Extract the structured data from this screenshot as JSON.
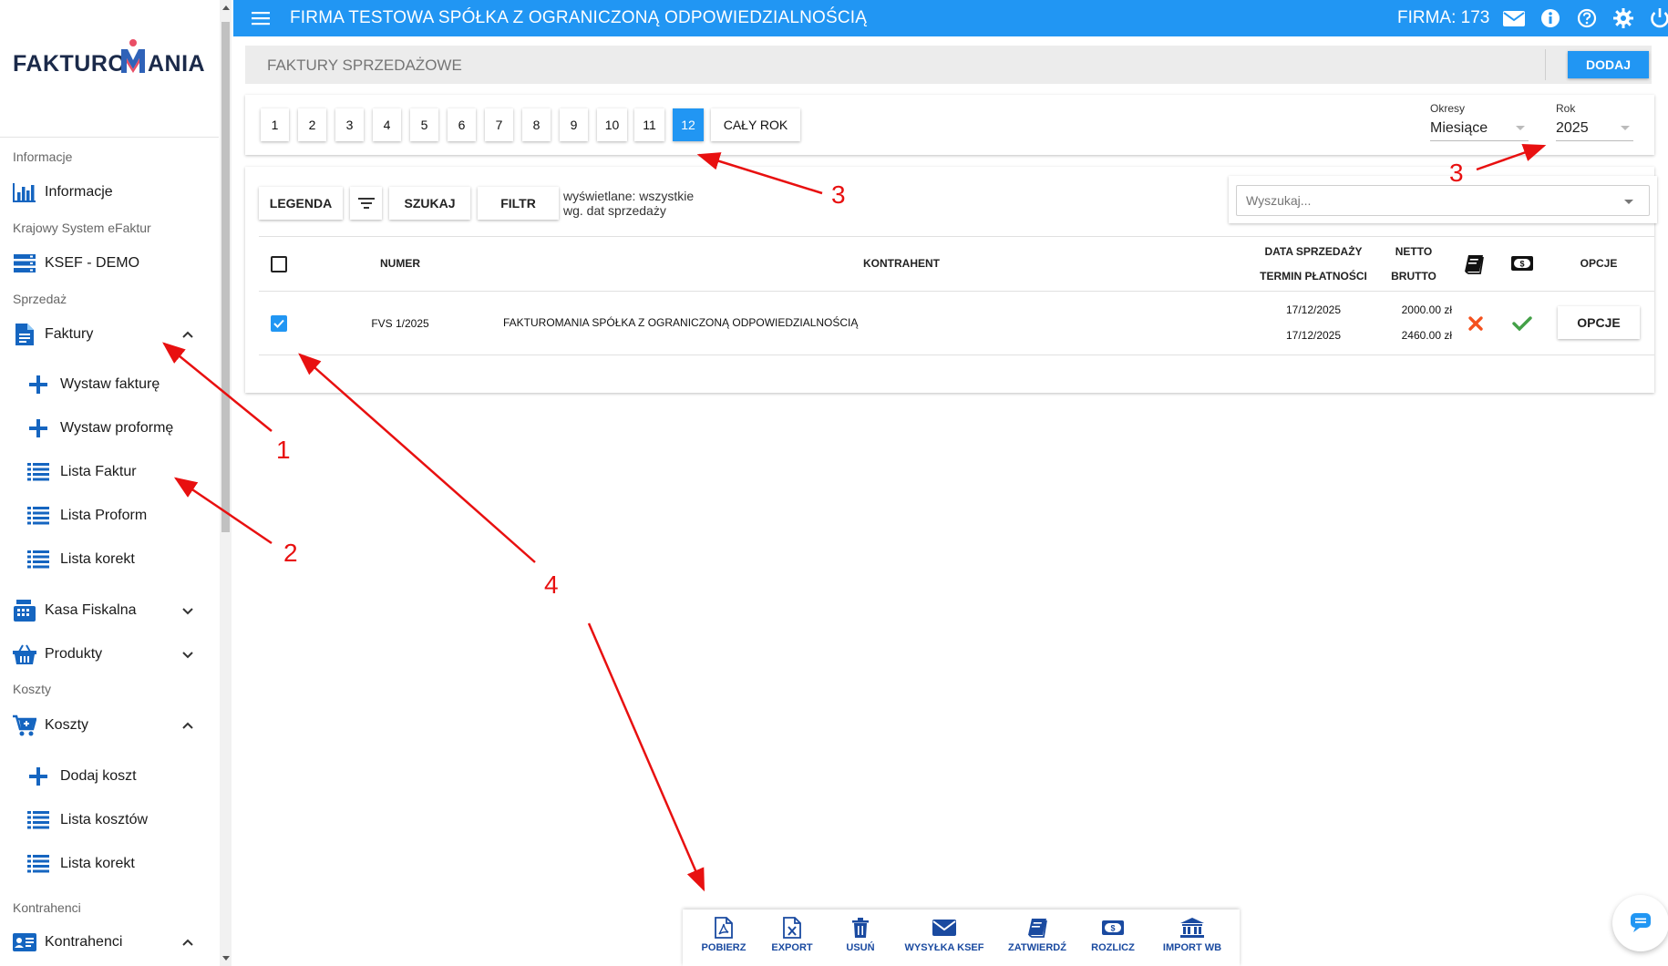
{
  "app": {
    "logo_text_left": "FAKTURO",
    "logo_text_right": "ANIA",
    "company_title": "FIRMA TESTOWA SPÓŁKA Z OGRANICZONĄ ODPOWIEDZIALNOŚCIĄ",
    "firma_label": "FIRMA: 173",
    "brand_color": "#2196f3"
  },
  "sidebar": {
    "sections": {
      "informacje": "Informacje",
      "ksef": "Krajowy System eFaktur",
      "sprzedaz": "Sprzedaż",
      "koszty": "Koszty",
      "kontrahenci": "Kontrahenci"
    },
    "items": {
      "informacje": "Informacje",
      "ksef_demo": "KSEF - DEMO",
      "faktury": "Faktury",
      "wystaw_fakture": "Wystaw fakturę",
      "wystaw_proforme": "Wystaw proformę",
      "lista_faktur": "Lista Faktur",
      "lista_proform": "Lista Proform",
      "lista_korekt": "Lista korekt",
      "kasa_fiskalna": "Kasa Fiskalna",
      "produkty": "Produkty",
      "koszty": "Koszty",
      "dodaj_koszt": "Dodaj koszt",
      "lista_kosztow": "Lista kosztów",
      "lista_korekt_koszty": "Lista korekt",
      "kontrahenci": "Kontrahenci"
    }
  },
  "header": {
    "title": "FAKTURY SPRZEDAŻOWE",
    "add_label": "DODAJ"
  },
  "periods": {
    "months": [
      "1",
      "2",
      "3",
      "4",
      "5",
      "6",
      "7",
      "8",
      "9",
      "10",
      "11",
      "12"
    ],
    "active_month": "12",
    "whole_year": "CAŁY ROK",
    "okresy_label": "Okresy",
    "okresy_value": "Miesiące",
    "rok_label": "Rok",
    "rok_value": "2025"
  },
  "toolbar": {
    "legenda": "LEGENDA",
    "szukaj": "SZUKAJ",
    "filtr": "FILTR",
    "info_line1": "wyświetlane: wszystkie",
    "info_line2": "wg. dat sprzedaży",
    "search_placeholder": "Wyszukaj..."
  },
  "table": {
    "headers": {
      "numer": "NUMER",
      "kontrahent": "KONTRAHENT",
      "data_sprzedazy": "DATA SPRZEDAŻY",
      "termin_platnosci": "TERMIN PŁATNOŚCI",
      "netto": "NETTO",
      "brutto": "BRUTTO",
      "opcje": "OPCJE"
    },
    "rows": [
      {
        "numer": "FVS 1/2025",
        "kontrahent": "FAKTUROMANIA SPÓŁKA Z OGRANICZONĄ ODPOWIEDZIALNOŚCIĄ",
        "data_sprzedazy": "17/12/2025",
        "termin_platnosci": "17/12/2025",
        "netto": "2000.00 zł",
        "brutto": "2460.00 zł",
        "opcje": "OPCJE",
        "checked": true
      }
    ]
  },
  "actions": {
    "pobierz": "POBIERZ",
    "export": "EXPORT",
    "usun": "USUŃ",
    "wysylka_ksef": "WYSYŁKA KSEF",
    "zatwierdz": "ZATWIERDŹ",
    "rozlicz": "ROZLICZ",
    "import_wb": "IMPORT WB"
  },
  "annotations": {
    "n1": "1",
    "n2": "2",
    "n3a": "3",
    "n3b": "3",
    "n4": "4"
  }
}
